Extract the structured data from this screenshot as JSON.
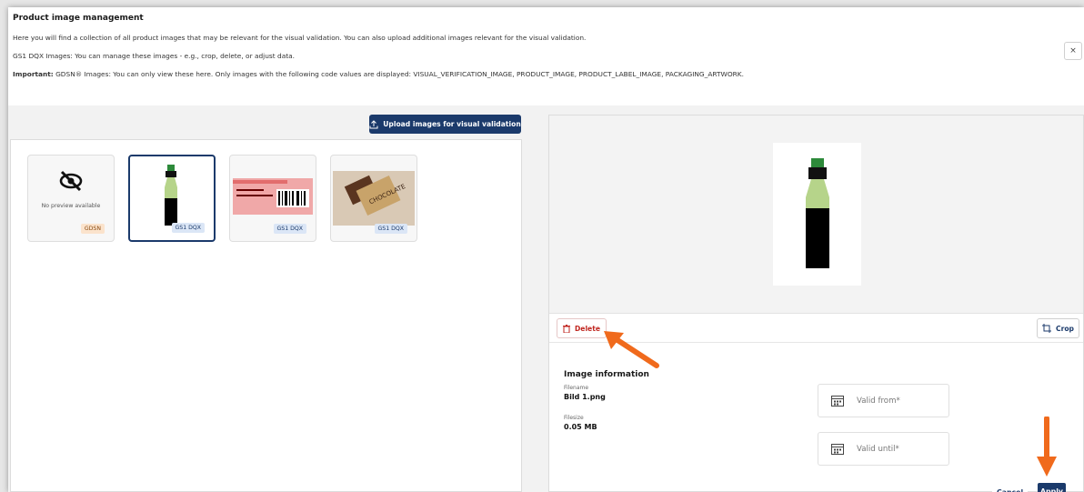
{
  "header": {
    "title": "Product image management",
    "line1": "Here you will find a collection of all product images that may be relevant for the visual validation. You can also upload additional images relevant for the visual validation.",
    "line2": "GS1 DQX Images: You can manage these images - e.g., crop, delete, or adjust data.",
    "line3_bold": "Important:",
    "line3_rest": " GDSN® Images: You can only view these here. Only images with the following code values are displayed: VISUAL_VERIFICATION_IMAGE, PRODUCT_IMAGE, PRODUCT_LABEL_IMAGE, PACKAGING_ARTWORK.",
    "close_label": "×"
  },
  "upload_button": "Upload images for visual validation",
  "thumbnails": [
    {
      "badge": "GDSN",
      "preview": "No preview available",
      "kind": "none"
    },
    {
      "badge": "GS1 DQX",
      "kind": "bottle",
      "selected": true
    },
    {
      "badge": "GS1 DQX",
      "kind": "label"
    },
    {
      "badge": "GS1 DQX",
      "kind": "chocolate"
    }
  ],
  "toolbar": {
    "delete": "Delete",
    "crop": "Crop"
  },
  "info": {
    "title": "Image information",
    "filename_label": "Filename",
    "filename": "Bild 1.png",
    "filesize_label": "Filesize",
    "filesize": "0.05 MB"
  },
  "fields": {
    "valid_from": "Valid from*",
    "valid_until": "Valid until*"
  },
  "footer": {
    "cancel": "Cancel",
    "apply": "Apply"
  },
  "colors": {
    "primary": "#1b3a6b",
    "danger": "#c0261f",
    "annotation": "#f06a1c"
  }
}
